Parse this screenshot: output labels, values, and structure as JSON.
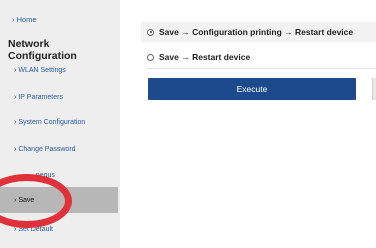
{
  "sidebar": {
    "home_link": "Home",
    "title": "Network Configuration",
    "items": [
      {
        "label": "WLAN Settings"
      },
      {
        "label": "IP Parameters"
      },
      {
        "label": "System Configuration"
      },
      {
        "label": "Change Password"
      },
      {
        "label": "...neous"
      },
      {
        "label": "Save"
      },
      {
        "label": "Set Default"
      }
    ]
  },
  "main": {
    "options": [
      {
        "label": "Save → Configuration printing → Restart device",
        "checked": true
      },
      {
        "label": "Save → Restart device",
        "checked": false
      }
    ],
    "execute_label": "Execute"
  },
  "colors": {
    "accent": "#1d4a8c",
    "annotation": "#e0303a",
    "active_item": "#b7b7b7"
  },
  "icons": [
    "chevron-right-icon",
    "radio-icon"
  ]
}
